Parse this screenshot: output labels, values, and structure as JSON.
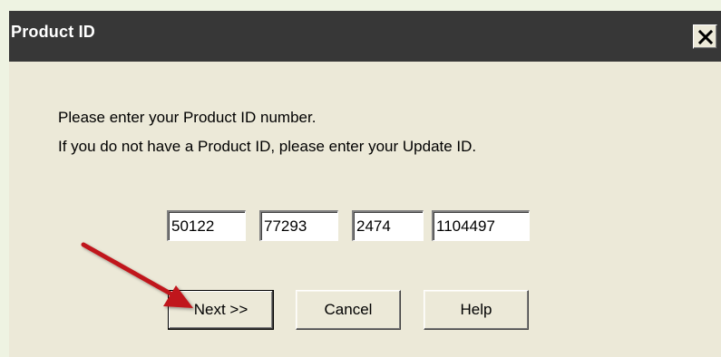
{
  "dialog": {
    "title": "Product ID",
    "close_glyph": "✕"
  },
  "message": {
    "line1": "Please enter your Product ID number.",
    "line2": "If you do not have a Product ID, please enter your Update ID."
  },
  "product_id": {
    "part1": "50122",
    "part2": "77293",
    "part3": "2474",
    "part4": "1104497"
  },
  "buttons": {
    "next": "Next >>",
    "cancel": "Cancel",
    "help": "Help"
  },
  "annotation": {
    "arrow_color": "#c0141a",
    "arrow_target": "next-button"
  },
  "colors": {
    "titlebar": "#373737",
    "dialog_bg": "#ece9d8",
    "page_bg": "#eef3e2"
  }
}
